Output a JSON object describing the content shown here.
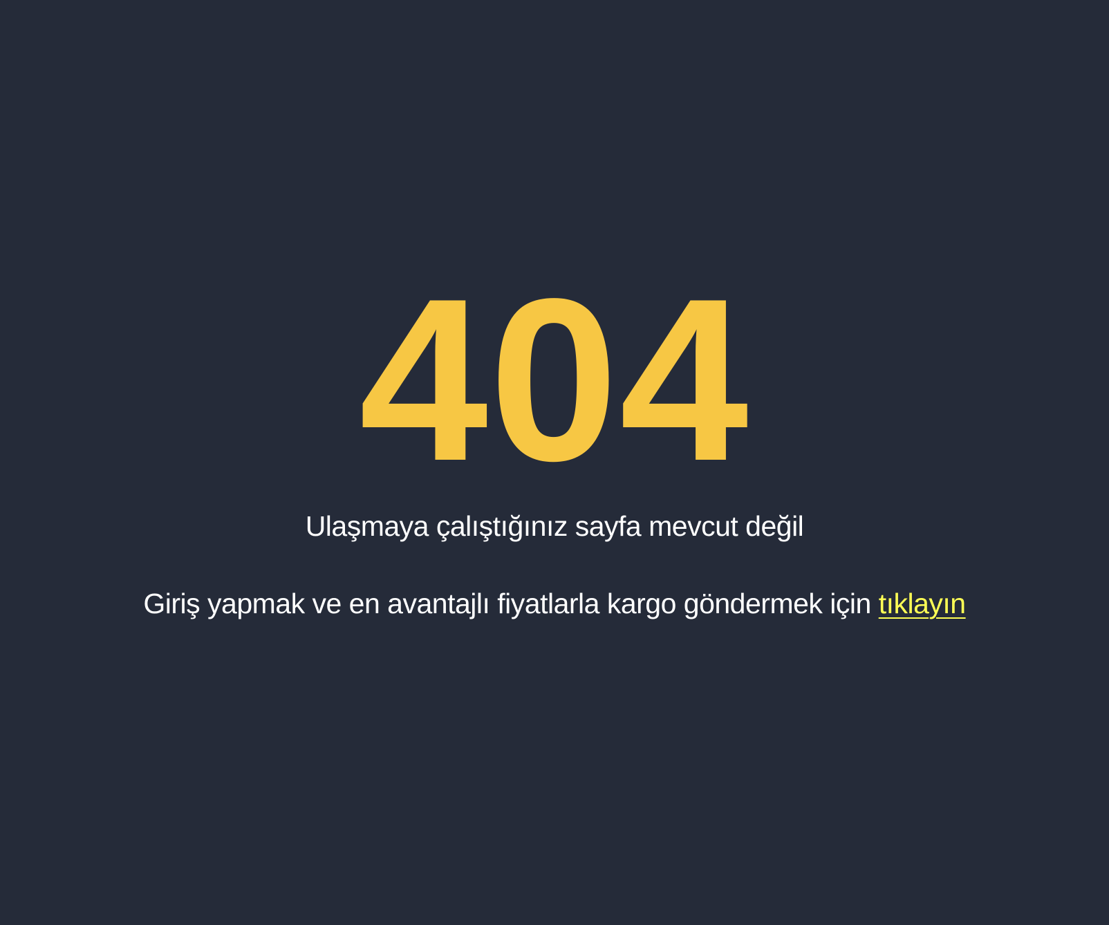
{
  "error": {
    "code": "404",
    "message": "Ulaşmaya çalıştığınız sayfa mevcut değil"
  },
  "cta": {
    "text": "Giriş yapmak ve en avantajlı fiyatlarla kargo göndermek için",
    "link_label": "tıklayın"
  },
  "colors": {
    "background": "#252b39",
    "accent": "#f7c744",
    "link": "#ffff55",
    "text": "#ffffff"
  }
}
